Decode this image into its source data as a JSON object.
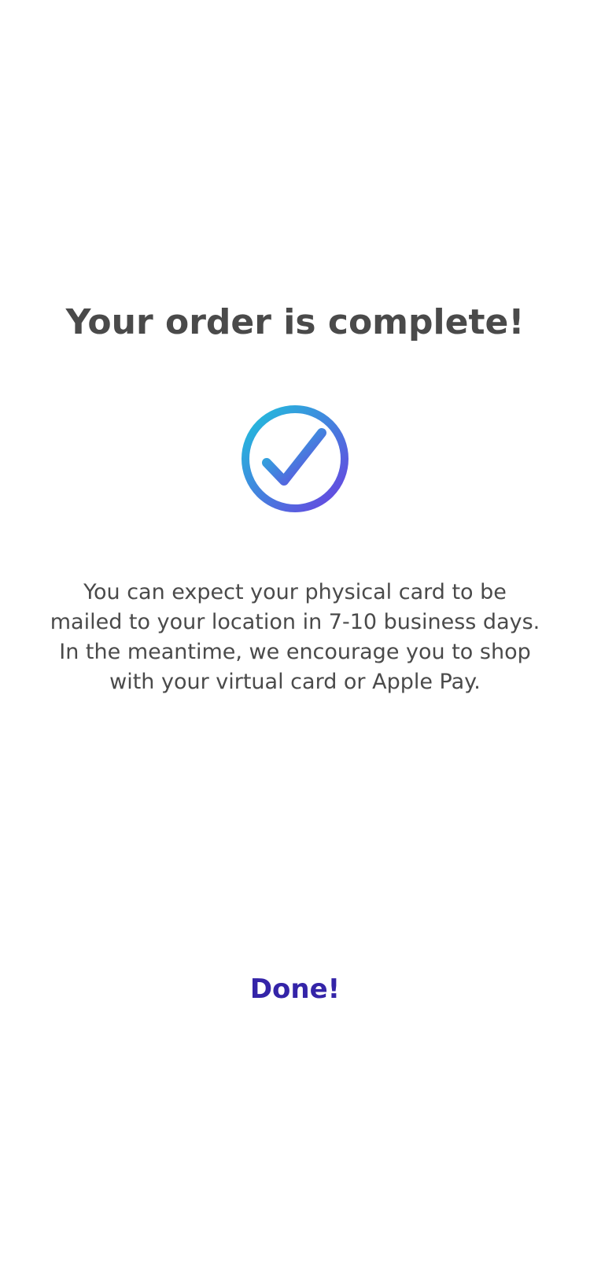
{
  "title": "Your order is complete!",
  "status_icon": "check-circle-icon",
  "message_lines": [
    "You can expect your physical card to be",
    "mailed to your location in 7-10 business days.",
    "In the meantime, we encourage you to shop",
    "with your virtual card or Apple Pay."
  ],
  "done_label": "Done!",
  "colors": {
    "text": "#4a4a4a",
    "accent": "#3424a8",
    "gradient_start": "#1ec3dc",
    "gradient_end": "#6a3fe0"
  }
}
